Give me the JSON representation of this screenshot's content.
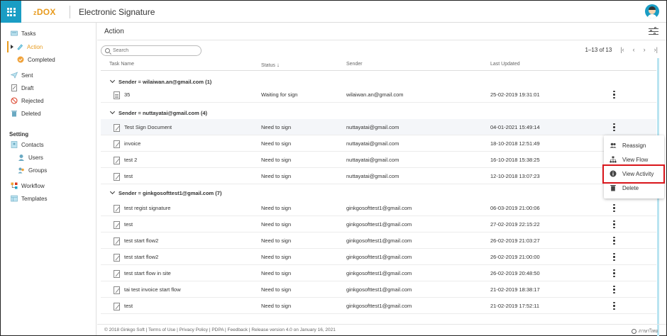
{
  "header": {
    "logo_small": "z",
    "logo_main": "DOX",
    "title": "Electronic Signature"
  },
  "sidebar": {
    "tasks": "Tasks",
    "action": "Action",
    "completed": "Completed",
    "sent": "Sent",
    "draft": "Draft",
    "rejected": "Rejected",
    "deleted": "Deleted",
    "setting_heading": "Setting",
    "contacts": "Contacts",
    "users": "Users",
    "groups": "Groups",
    "workflow": "Workflow",
    "templates": "Templates"
  },
  "main": {
    "title": "Action",
    "search_placeholder": "Search",
    "pager": "1–13 of 13",
    "columns": {
      "task": "Task Name",
      "status": "Status",
      "sender": "Sender",
      "updated": "Last Updated"
    },
    "groups": [
      "Sender = wilaiwan.an@gmail.com (1)",
      "Sender = nuttayatai@gmail.com (4)",
      "Sender = ginkgosofttest1@gmail.com (7)"
    ],
    "rows": [
      {
        "name": "35",
        "status": "Waiting for sign",
        "sender": "wilaiwan.an@gmail.com",
        "updated": "25-02-2019 19:31:01"
      },
      {
        "name": "Test Sign Document",
        "status": "Need to sign",
        "sender": "nuttayatai@gmail.com",
        "updated": "04-01-2021 15:49:14"
      },
      {
        "name": "invoice",
        "status": "Need to sign",
        "sender": "nuttayatai@gmail.com",
        "updated": "18-10-2018 12:51:49"
      },
      {
        "name": "test 2",
        "status": "Need to sign",
        "sender": "nuttayatai@gmail.com",
        "updated": "16-10-2018 15:38:25"
      },
      {
        "name": "test",
        "status": "Need to sign",
        "sender": "nuttayatai@gmail.com",
        "updated": "12-10-2018 13:07:23"
      },
      {
        "name": "test regist signature",
        "status": "Need to sign",
        "sender": "ginkgosofttest1@gmail.com",
        "updated": "06-03-2019 21:00:06"
      },
      {
        "name": "test",
        "status": "Need to sign",
        "sender": "ginkgosofttest1@gmail.com",
        "updated": "27-02-2019 22:15:22"
      },
      {
        "name": "test start flow2",
        "status": "Need to sign",
        "sender": "ginkgosofttest1@gmail.com",
        "updated": "26-02-2019 21:03:27"
      },
      {
        "name": "test start flow2",
        "status": "Need to sign",
        "sender": "ginkgosofttest1@gmail.com",
        "updated": "26-02-2019 21:00:00"
      },
      {
        "name": "test start flow in site",
        "status": "Need to sign",
        "sender": "ginkgosofttest1@gmail.com",
        "updated": "26-02-2019 20:48:50"
      },
      {
        "name": "tai test invoice start flow",
        "status": "Need to sign",
        "sender": "ginkgosofttest1@gmail.com",
        "updated": "21-02-2019 18:38:17"
      },
      {
        "name": "test",
        "status": "Need to sign",
        "sender": "ginkgosofttest1@gmail.com",
        "updated": "21-02-2019 17:52:11"
      }
    ]
  },
  "menu": {
    "reassign": "Reassign",
    "view_flow": "View Flow",
    "view_activity": "View Activity",
    "delete": "Delete"
  },
  "footer": {
    "text": "© 2018 Ginkgo Soft  |  Terms of Use  |  Privacy Policy  |  PDPA  |  Feedback  |  Release version 4.0 on January 16, 2021",
    "language": "ภาษาไทย"
  },
  "colors": {
    "accent": "#1a9dc4",
    "brand": "#e89b1e",
    "highlight": "#d9151b"
  }
}
